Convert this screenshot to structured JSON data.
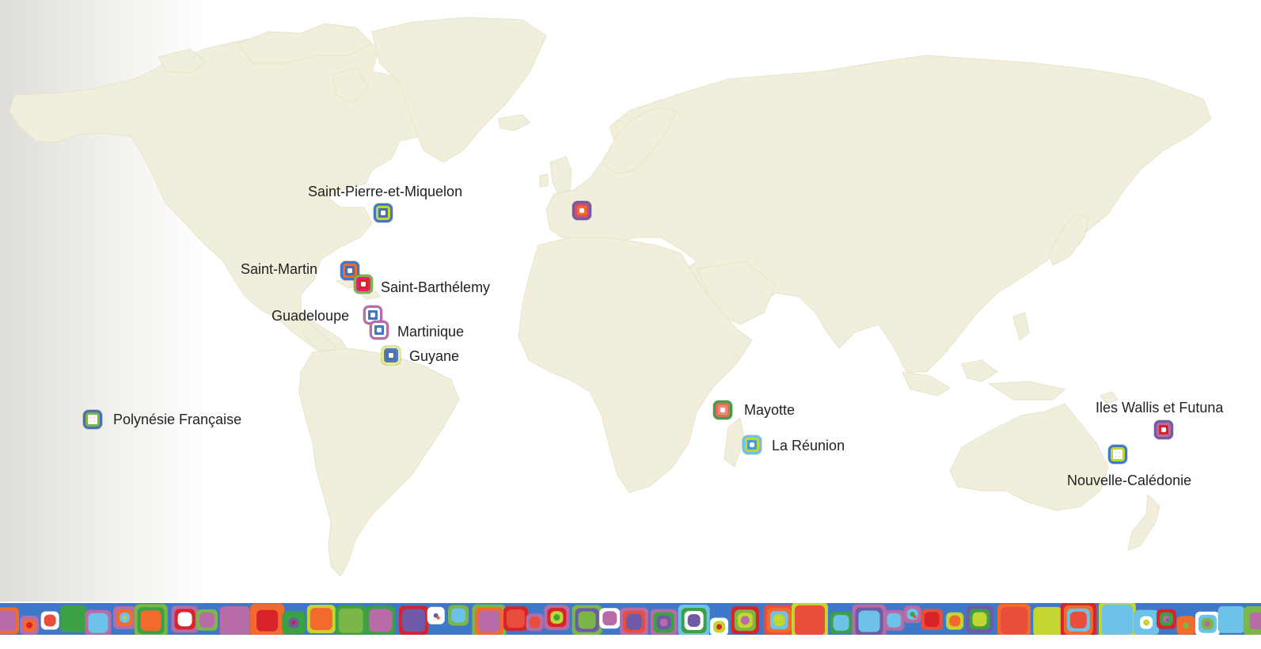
{
  "map": {
    "territories": [
      {
        "id": "saint-pierre-et-miquelon",
        "label": "Saint-Pierre-et-Miquelon",
        "marker_colors": [
          "#7ab648",
          "#3f78c8",
          "#c3d531",
          "#4b6fb4"
        ]
      },
      {
        "id": "france-metropole",
        "label": "",
        "marker_colors": [
          "#e94e3c",
          "#6f5aa8",
          "#d94a6e",
          "#f26a2c"
        ]
      },
      {
        "id": "saint-martin",
        "label": "Saint-Martin",
        "marker_colors": [
          "#7ab648",
          "#3f78c8",
          "#f26a2c",
          "#4b6fb4"
        ]
      },
      {
        "id": "saint-barthelemy",
        "label": "Saint-Barthélemy",
        "marker_colors": [
          "#f26a2c",
          "#7ab648",
          "#e0246b",
          "#d8232a"
        ]
      },
      {
        "id": "guadeloupe",
        "label": "Guadeloupe",
        "marker_colors": [
          "#e94e3c",
          "#b76ca8",
          "#ffffff",
          "#3f78c8"
        ]
      },
      {
        "id": "martinique",
        "label": "Martinique",
        "marker_colors": [
          "#7ab648",
          "#b76ca8",
          "#ffffff",
          "#3f78c8"
        ]
      },
      {
        "id": "guyane",
        "label": "Guyane",
        "marker_colors": [
          "#c3d531",
          "#e9f07a",
          "#5577c4",
          "#4b6fb4"
        ]
      },
      {
        "id": "polynesie-francaise",
        "label": "Polynésie Française",
        "marker_colors": [
          "#e94e3c",
          "#4b6fb4",
          "#7ab648",
          "#ffffff"
        ]
      },
      {
        "id": "mayotte",
        "label": "Mayotte",
        "marker_colors": [
          "#7ab648",
          "#3ca144",
          "#e96a57",
          "#f08d7a"
        ]
      },
      {
        "id": "la-reunion",
        "label": "La Réunion",
        "marker_colors": [
          "#3f78c8",
          "#6cc2e8",
          "#c3d531",
          "#3ca0d6"
        ]
      },
      {
        "id": "iles-wallis-et-futuna",
        "label": "Iles Wallis et Futuna",
        "marker_colors": [
          "#e94e3c",
          "#6f5aa8",
          "#b76ca8",
          "#d8232a"
        ]
      },
      {
        "id": "nouvelle-caledonie",
        "label": "Nouvelle-Calédonie",
        "marker_colors": [
          "#7ab648",
          "#3f78c8",
          "#c3d531",
          "#ffffff"
        ]
      }
    ],
    "colors": {
      "land": "#f1efdc",
      "land_stroke": "#e4e1c6",
      "background": "#ffffff",
      "strip_base": "#3f78c8"
    }
  }
}
